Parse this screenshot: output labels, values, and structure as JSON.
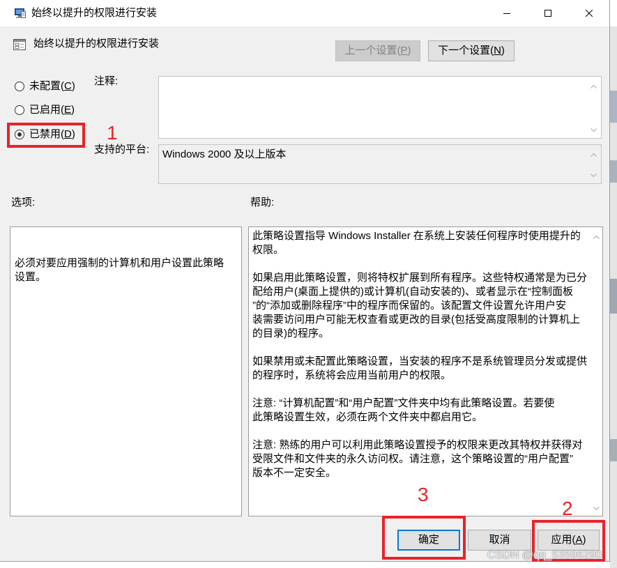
{
  "window": {
    "title": "始终以提升的权限进行安装"
  },
  "header": {
    "title": "始终以提升的权限进行安装",
    "prev_button": {
      "text": "上一个设置(",
      "key": "P",
      "suffix": ")",
      "disabled": true
    },
    "next_button": {
      "text": "下一个设置(",
      "key": "N",
      "suffix": ")",
      "disabled": false
    }
  },
  "state": {
    "options": [
      {
        "text": "未配置(",
        "key": "C",
        "suffix": ")",
        "checked": false
      },
      {
        "text": "已启用(",
        "key": "E",
        "suffix": ")",
        "checked": false
      },
      {
        "text": "已禁用(",
        "key": "D",
        "suffix": ")",
        "checked": true
      }
    ]
  },
  "comment": {
    "label": "注释:"
  },
  "platform": {
    "label": "支持的平台:",
    "value": "Windows 2000 及以上版本"
  },
  "options_panel": {
    "label": "选项:",
    "lines": [
      "必须对要应用强制的计算机和用户设置此策略",
      "设置。"
    ]
  },
  "help_panel": {
    "label": "帮助:",
    "paragraphs": [
      [
        "此策略设置指导 Windows Installer 在系统上安装任何程序时使用提升的",
        "权限。"
      ],
      [
        "如果启用此策略设置，则将特权扩展到所有程序。这些特权通常是为已分",
        "配给用户(桌面上提供的)或计算机(自动安装的)、或者显示在“控制面板",
        "”的“添加或删除程序”中的程序而保留的。该配置文件设置允许用户安",
        "装需要访问用户可能无权查看或更改的目录(包括受高度限制的计算机上",
        "的目录)的程序。"
      ],
      [
        "如果禁用或未配置此策略设置，当安装的程序不是系统管理员分发或提供",
        "的程序时，系统将会应用当前用户的权限。"
      ],
      [
        "注意: “计算机配置”和“用户配置”文件夹中均有此策略设置。若要使",
        "此策略设置生效，必须在两个文件夹中都启用它。"
      ],
      [
        "注意: 熟练的用户可以利用此策略设置授予的权限来更改其特权并获得对",
        "受限文件和文件夹的永久访问权。请注意，这个策略设置的“用户配置”",
        "版本不一定安全。"
      ]
    ]
  },
  "footer": {
    "ok": "确定",
    "cancel": "取消",
    "apply": {
      "text": "应用(",
      "key": "A",
      "suffix": ")"
    }
  },
  "annotations": [
    {
      "label": "1"
    },
    {
      "label": "2"
    },
    {
      "label": "3"
    }
  ],
  "watermark": "CSDN @qq_53596290",
  "icons": {
    "app": "group-policy-icon",
    "setting": "policy-setting-icon",
    "minimize": "minimize-icon",
    "maximize": "maximize-icon",
    "close": "close-icon",
    "scroll_up": "chevron-up-icon",
    "scroll_down": "chevron-down-icon"
  },
  "colors": {
    "accent": "#0078d7",
    "annotation": "#e8232a",
    "dialog_background": "#f0f0f0",
    "title_bar": "#ffffff"
  }
}
